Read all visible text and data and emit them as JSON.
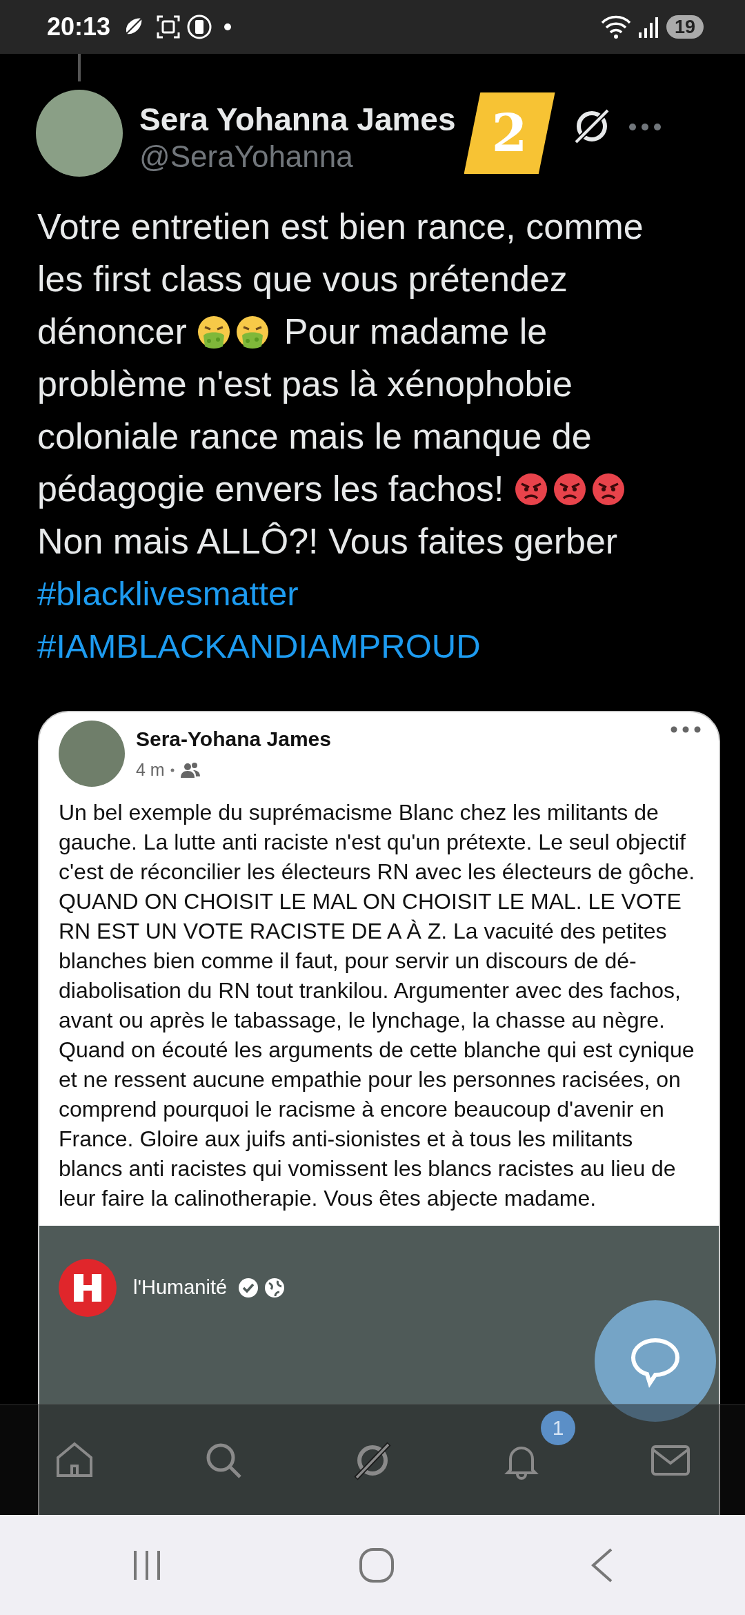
{
  "status_bar": {
    "time": "20:13",
    "battery": "19"
  },
  "tweet": {
    "author": {
      "name": "Sera Yohanna James",
      "handle": "@SeraYohanna"
    },
    "sticker": "2",
    "segments": [
      {
        "kind": "text",
        "text": "Votre entretien est bien rance, comme les first class que vous prétendez dénoncer "
      },
      {
        "kind": "vomit_emoji"
      },
      {
        "kind": "vomit_emoji"
      },
      {
        "kind": "text",
        "text": " Pour madame le problème n'est pas là xénophobie coloniale rance mais le manque de pédagogie envers les fachos! "
      },
      {
        "kind": "angry_emoji"
      },
      {
        "kind": "angry_emoji"
      },
      {
        "kind": "angry_emoji"
      },
      {
        "kind": "text",
        "text": " Non mais ALLÔ?! Vous faites gerber"
      }
    ],
    "hashtags": [
      "#blacklivesmatter",
      "#IAMBLACKANDIAMPROUD"
    ],
    "quoted_post": {
      "author": "Sera-Yohana James",
      "time": "4 m",
      "text": "Un bel exemple du suprémacisme Blanc chez les militants de gauche. La lutte anti raciste n'est qu'un prétexte. Le seul objectif c'est de réconcilier les électeurs RN avec les électeurs de gôche. QUAND ON CHOISIT LE MAL ON CHOISIT LE MAL. LE VOTE RN EST UN VOTE RACISTE DE A À Z. La vacuité des petites blanches bien comme il faut, pour servir un discours de dé-diabolisation du RN tout trankilou. Argumenter avec des fachos, avant ou après le tabassage, le lynchage, la chasse au nègre.  Quand on écouté les arguments de cette blanche  qui est cynique et ne ressent aucune empathie pour les personnes racisées, on comprend pourquoi le racisme à encore beaucoup d'avenir en France. Gloire aux juifs anti-sionistes et à tous les militants blancs anti racistes qui vomissent les blancs racistes au lieu de leur faire la calinotherapie. Vous êtes abjecte madame.",
      "video": {
        "channel": "l'Humanité"
      }
    }
  },
  "bottom_nav": {
    "items": [
      {
        "kind": "home"
      },
      {
        "kind": "search"
      },
      {
        "kind": "grok"
      },
      {
        "kind": "notifications",
        "badge": "1"
      },
      {
        "kind": "messages"
      }
    ]
  }
}
